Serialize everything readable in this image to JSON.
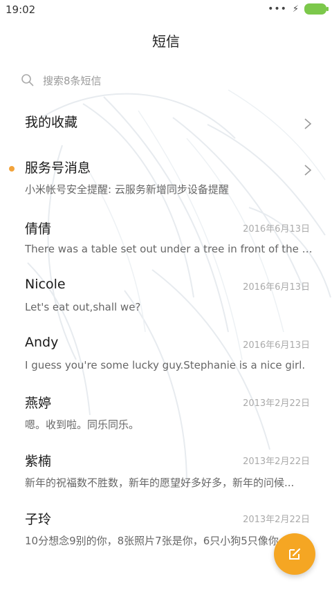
{
  "status_bar": {
    "time": "19:02",
    "signal_glyph": "•••",
    "charging_glyph": "⚡",
    "battery_color": "#7cc84b"
  },
  "header": {
    "title": "短信"
  },
  "search": {
    "placeholder": "搜索8条短信"
  },
  "favorites": {
    "label": "我的收藏"
  },
  "service": {
    "title": "服务号消息",
    "preview": "小米帐号安全提醒: 云服务新增同步设备提醒",
    "unread_color": "#f2a33b"
  },
  "conversations": [
    {
      "name": "倩倩",
      "date": "2016年6月13日",
      "preview": "There was a table set out under a tree in front of the ho..."
    },
    {
      "name": "Nicole",
      "date": "2016年6月13日",
      "preview": "Let's eat out,shall we?"
    },
    {
      "name": "Andy",
      "date": "2016年6月13日",
      "preview": "I guess you're some lucky guy.Stephanie is a nice girl."
    },
    {
      "name": "燕婷",
      "date": "2013年2月22日",
      "preview": "嗯。收到啦。同乐同乐。"
    },
    {
      "name": "紫楠",
      "date": "2013年2月22日",
      "preview": "新年的祝福数不胜数，新年的愿望好多好多，新年的问候..."
    },
    {
      "name": "子玲",
      "date": "2013年2月22日",
      "preview": "10分想念9别的你，8张照片7张是你，6只小狗5只像你..."
    }
  ],
  "fab": {
    "icon": "compose-icon",
    "color": "#f5a623"
  }
}
